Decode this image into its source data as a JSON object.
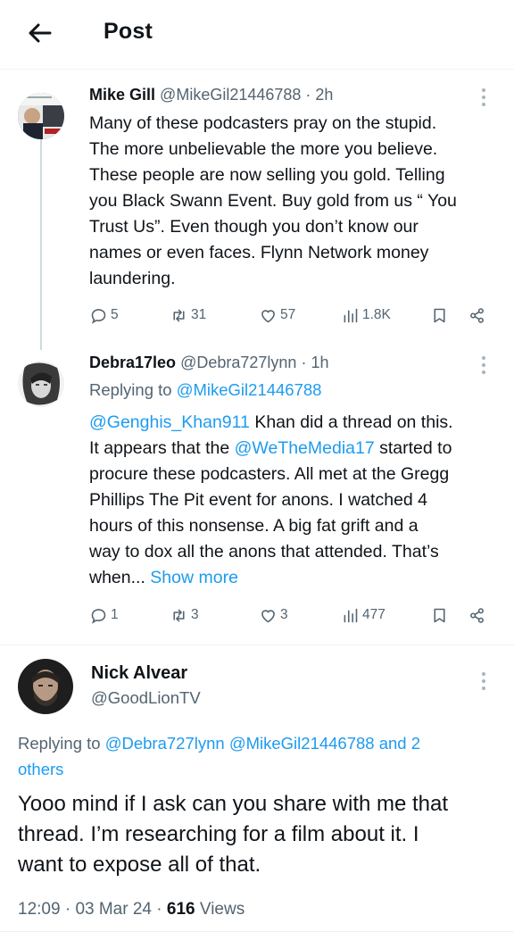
{
  "header": {
    "title": "Post"
  },
  "tweets": [
    {
      "name": "Mike Gill",
      "handle": "@MikeGil21446788",
      "time": "2h",
      "lines": [
        "Many of these podcasters pray on the stupid.",
        "The more unbelievable the more you believe.",
        "These people are now selling you gold. Telling",
        "you Black Swann Event. Buy gold from us “ You",
        "Trust Us”.  Even though you don’t know our",
        "names or even faces. Flynn Network money",
        "laundering."
      ],
      "replies": "5",
      "reposts": "31",
      "likes": "57",
      "views": "1.8K"
    },
    {
      "name": "Debra17leo",
      "handle": "@Debra727lynn",
      "time": "1h",
      "replying_label": "Replying to",
      "replying_to": "@MikeGil21446788",
      "mention_1": "@Genghis_Khan911",
      "line1_rest": " Khan did a thread on this.",
      "line2_pre": "It appears that the ",
      "mention_2": "@WeTheMedia17",
      "line2_rest": " started to",
      "lines_plain": [
        "procure these podcasters. All met at the Gregg",
        "Phillips The Pit event for anons. I watched 4",
        "hours of this nonsense. A big fat grift and a",
        "way to dox all the anons that attended. That’s"
      ],
      "last_line": "when...",
      "show_more": "Show more",
      "replies": "1",
      "reposts": "3",
      "likes": "3",
      "views": "477"
    }
  ],
  "main": {
    "name": "Nick Alvear",
    "handle": "@GoodLionTV",
    "replying_label": "Replying to",
    "replying_1": "@Debra727lynn",
    "replying_2": "@MikeGil21446788",
    "replying_3": "and 2",
    "replying_4": "others",
    "text_lines": [
      "Yooo mind if I ask can you share with me that",
      "thread. I’m researching for a film about it. I",
      "want to expose all of that."
    ],
    "time": "12:09",
    "date": "03 Mar 24",
    "views_count": "616",
    "views_label": "Views"
  },
  "colors": {
    "accent": "#1d9bf0",
    "muted": "#536471",
    "text": "#0f1419",
    "line": "#cfd9de"
  }
}
